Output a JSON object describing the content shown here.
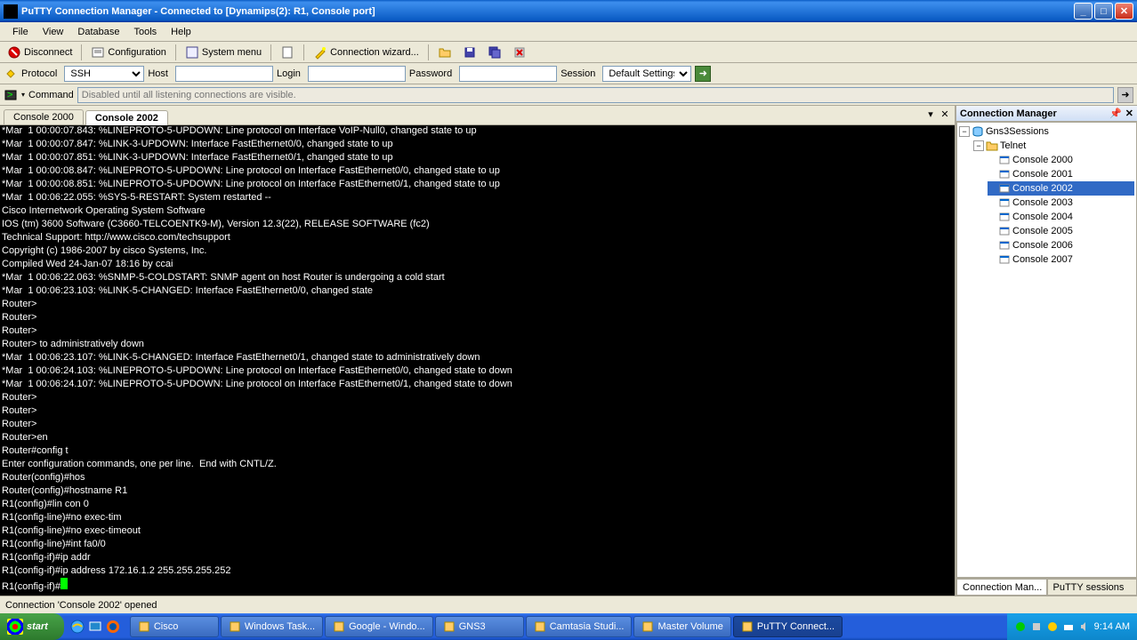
{
  "window": {
    "title": "PuTTY Connection Manager - Connected to [Dynamips(2): R1, Console port]"
  },
  "menubar": [
    "File",
    "View",
    "Database",
    "Tools",
    "Help"
  ],
  "toolbar1": {
    "disconnect": "Disconnect",
    "configuration": "Configuration",
    "system_menu": "System menu",
    "connection_wizard": "Connection wizard..."
  },
  "toolbar2": {
    "protocol_label": "Protocol",
    "protocol_value": "SSH",
    "host_label": "Host",
    "host_value": "",
    "login_label": "Login",
    "login_value": "",
    "password_label": "Password",
    "password_value": "",
    "session_label": "Session",
    "session_value": "Default Settings"
  },
  "toolbar3": {
    "command_label": "Command",
    "command_placeholder": "Disabled until all listening connections are visible."
  },
  "tabs": [
    {
      "label": "Console 2000",
      "active": false
    },
    {
      "label": "Console 2002",
      "active": true
    }
  ],
  "terminal_lines": [
    "*Mar  1 00:00:07.843: %LINEPROTO-5-UPDOWN: Line protocol on Interface VoIP-Null0, changed state to up",
    "*Mar  1 00:00:07.847: %LINK-3-UPDOWN: Interface FastEthernet0/0, changed state to up",
    "*Mar  1 00:00:07.851: %LINK-3-UPDOWN: Interface FastEthernet0/1, changed state to up",
    "*Mar  1 00:00:08.847: %LINEPROTO-5-UPDOWN: Line protocol on Interface FastEthernet0/0, changed state to up",
    "*Mar  1 00:00:08.851: %LINEPROTO-5-UPDOWN: Line protocol on Interface FastEthernet0/1, changed state to up",
    "*Mar  1 00:06:22.055: %SYS-5-RESTART: System restarted --",
    "Cisco Internetwork Operating System Software",
    "IOS (tm) 3600 Software (C3660-TELCOENTK9-M), Version 12.3(22), RELEASE SOFTWARE (fc2)",
    "Technical Support: http://www.cisco.com/techsupport",
    "Copyright (c) 1986-2007 by cisco Systems, Inc.",
    "Compiled Wed 24-Jan-07 18:16 by ccai",
    "*Mar  1 00:06:22.063: %SNMP-5-COLDSTART: SNMP agent on host Router is undergoing a cold start",
    "*Mar  1 00:06:23.103: %LINK-5-CHANGED: Interface FastEthernet0/0, changed state",
    "Router>",
    "Router>",
    "Router>",
    "Router> to administratively down",
    "*Mar  1 00:06:23.107: %LINK-5-CHANGED: Interface FastEthernet0/1, changed state to administratively down",
    "*Mar  1 00:06:24.103: %LINEPROTO-5-UPDOWN: Line protocol on Interface FastEthernet0/0, changed state to down",
    "*Mar  1 00:06:24.107: %LINEPROTO-5-UPDOWN: Line protocol on Interface FastEthernet0/1, changed state to down",
    "Router>",
    "Router>",
    "Router>",
    "Router>en",
    "Router#config t",
    "Enter configuration commands, one per line.  End with CNTL/Z.",
    "Router(config)#hos",
    "Router(config)#hostname R1",
    "R1(config)#lin con 0",
    "R1(config-line)#no exec-tim",
    "R1(config-line)#no exec-timeout",
    "R1(config-line)#int fa0/0",
    "R1(config-if)#ip addr",
    "R1(config-if)#ip address 172.16.1.2 255.255.255.252",
    "R1(config-if)#"
  ],
  "connection_manager": {
    "title": "Connection Manager",
    "tree": {
      "root": "Gns3Sessions",
      "group": "Telnet",
      "sessions": [
        "Console 2000",
        "Console 2001",
        "Console 2002",
        "Console 2003",
        "Console 2004",
        "Console 2005",
        "Console 2006",
        "Console 2007"
      ],
      "selected": "Console 2002"
    },
    "bottom_tabs": [
      {
        "label": "Connection Man...",
        "active": true
      },
      {
        "label": "PuTTY sessions",
        "active": false
      }
    ]
  },
  "statusbar": "Connection 'Console 2002' opened",
  "taskbar": {
    "start": "start",
    "buttons": [
      {
        "label": "Cisco",
        "active": false
      },
      {
        "label": "Windows Task...",
        "active": false
      },
      {
        "label": "Google - Windo...",
        "active": false
      },
      {
        "label": "GNS3",
        "active": false
      },
      {
        "label": "Camtasia Studi...",
        "active": false
      },
      {
        "label": "Master Volume",
        "active": false
      },
      {
        "label": "PuTTY Connect...",
        "active": true
      }
    ],
    "time": "9:14 AM"
  }
}
